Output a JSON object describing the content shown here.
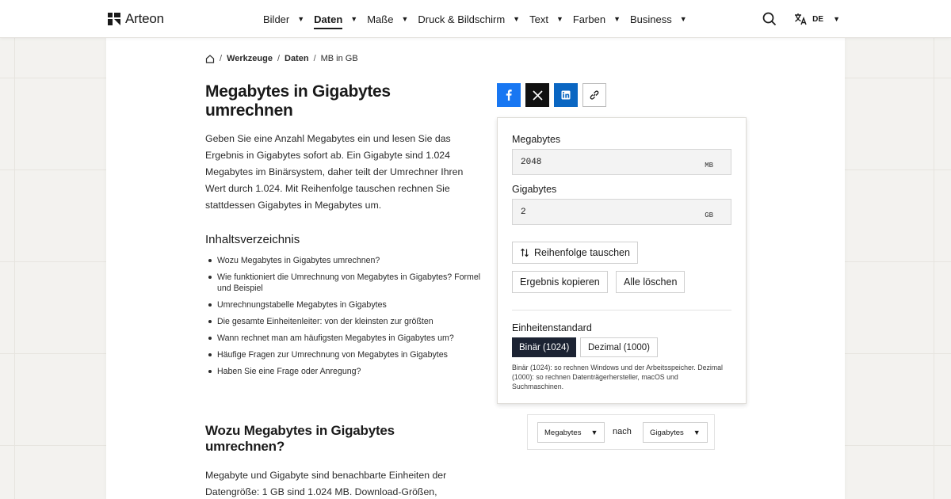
{
  "brand": {
    "name": "Arteon"
  },
  "nav": {
    "items": [
      {
        "label": "Bilder",
        "active": false
      },
      {
        "label": "Daten",
        "active": true
      },
      {
        "label": "Maße",
        "active": false
      },
      {
        "label": "Druck & Bildschirm",
        "active": false
      },
      {
        "label": "Text",
        "active": false
      },
      {
        "label": "Farben",
        "active": false
      },
      {
        "label": "Business",
        "active": false
      }
    ],
    "language": "DE"
  },
  "breadcrumb": {
    "items": [
      "Werkzeuge",
      "Daten",
      "MB in GB"
    ]
  },
  "page": {
    "title": "Megabytes in Gigabytes umrechnen",
    "intro": "Geben Sie eine Anzahl Megabytes ein und lesen Sie das Ergebnis in Gigabytes sofort ab. Ein Gigabyte sind 1.024 Megabytes im Binärsystem, daher teilt der Umrechner Ihren Wert durch 1.024. Mit Reihenfolge tauschen rechnen Sie stattdessen Gigabytes in Megabytes um."
  },
  "toc": {
    "title": "Inhaltsverzeichnis",
    "items": [
      "Wozu Megabytes in Gigabytes umrechnen?",
      "Wie funktioniert die Umrechnung von Megabytes in Gigabytes? Formel und Beispiel",
      "Umrechnungstabelle Megabytes in Gigabytes",
      "Die gesamte Einheitenleiter: von der kleinsten zur größten",
      "Wann rechnet man am häufigsten Megabytes in Gigabytes um?",
      "Häufige Fragen zur Umrechnung von Megabytes in Gigabytes",
      "Haben Sie eine Frage oder Anregung?"
    ]
  },
  "section1": {
    "title": "Wozu Megabytes in Gigabytes umrechnen?",
    "text": "Megabyte und Gigabyte sind benachbarte Einheiten der Datengröße: 1 GB sind 1.024 MB. Download-Größen,"
  },
  "calculator": {
    "input_label": "Megabytes",
    "input_value": "2048",
    "input_unit": "MB",
    "output_label": "Gigabytes",
    "output_value": "2",
    "output_unit": "GB",
    "swap_label": "Reihenfolge tauschen",
    "copy_label": "Ergebnis kopieren",
    "clear_label": "Alle löschen",
    "standard_label": "Einheitenstandard",
    "standard_options": [
      "Binär (1024)",
      "Dezimal (1000)"
    ],
    "standard_selected": 0,
    "standard_note": "Binär (1024): so rechnen Windows und der Arbeitsspeicher. Dezimal (1000): so rechnen Datenträgerhersteller, macOS und Suchmaschinen."
  },
  "converter_pair": {
    "from": "Megabytes",
    "connector": "nach",
    "to": "Gigabytes"
  },
  "colors": {
    "facebook": "#1877f2",
    "x": "#111111",
    "linkedin": "#0a66c2",
    "active_segment": "#1c2333"
  },
  "icons": {
    "share": [
      "facebook-icon",
      "x-icon",
      "linkedin-icon",
      "link-icon"
    ],
    "header": [
      "search-icon",
      "translate-icon"
    ]
  }
}
